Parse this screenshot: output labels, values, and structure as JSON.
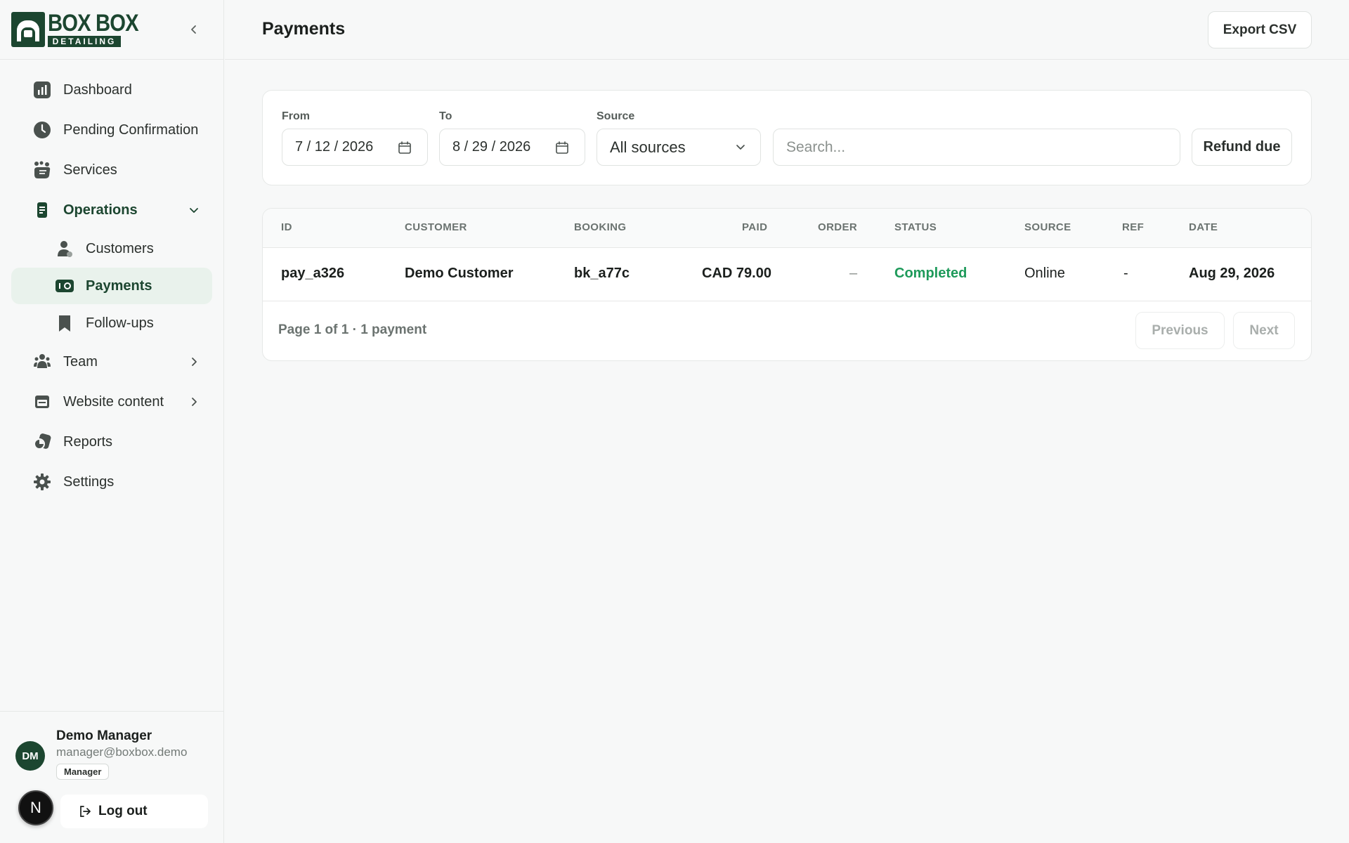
{
  "brand": {
    "line1": "BOX BOX",
    "line2": "DETAILING"
  },
  "sidebar": {
    "items": [
      {
        "label": "Dashboard"
      },
      {
        "label": "Pending Confirmation"
      },
      {
        "label": "Services"
      },
      {
        "label": "Operations"
      },
      {
        "label": "Customers"
      },
      {
        "label": "Payments"
      },
      {
        "label": "Follow-ups"
      },
      {
        "label": "Team"
      },
      {
        "label": "Website content"
      },
      {
        "label": "Reports"
      },
      {
        "label": "Settings"
      }
    ]
  },
  "user": {
    "initials": "DM",
    "name": "Demo Manager",
    "email": "manager@boxbox.demo",
    "role": "Manager",
    "logout_label": "Log out",
    "badge_letter": "N"
  },
  "header": {
    "title": "Payments",
    "export_label": "Export CSV"
  },
  "filters": {
    "from_label": "From",
    "from_value": "7 / 12 / 2026",
    "to_label": "To",
    "to_value": "8 / 29 / 2026",
    "source_label": "Source",
    "source_value": "All sources",
    "search_placeholder": "Search...",
    "refund_label": "Refund due"
  },
  "table": {
    "columns": [
      "ID",
      "CUSTOMER",
      "BOOKING",
      "PAID",
      "ORDER",
      "STATUS",
      "SOURCE",
      "REF",
      "DATE"
    ],
    "rows": [
      {
        "id": "pay_a326",
        "customer": "Demo Customer",
        "booking": "bk_a77c",
        "paid": "CAD 79.00",
        "order": "–",
        "status": "Completed",
        "source": "Online",
        "ref": "-",
        "date": "Aug 29, 2026"
      }
    ],
    "pagination": {
      "summary": "Page 1 of 1 · 1 payment",
      "prev_label": "Previous",
      "next_label": "Next"
    }
  },
  "colors": {
    "brand": "#1c4630",
    "status_completed": "#1e9a5a",
    "active_bg": "#e9f2ec"
  }
}
